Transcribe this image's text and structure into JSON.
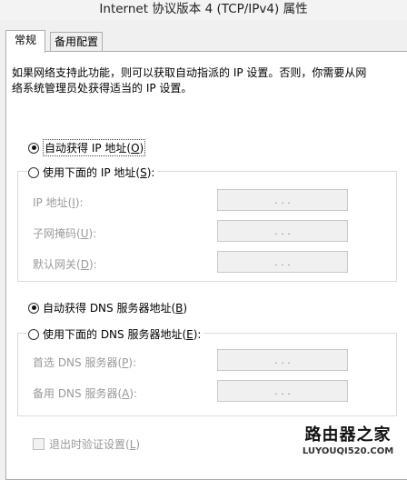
{
  "window": {
    "title": "Internet 协议版本 4 (TCP/IPv4) 属性"
  },
  "tabs": [
    {
      "label": "常规",
      "active": true
    },
    {
      "label": "备用配置",
      "active": false
    }
  ],
  "description": "如果网络支持此功能，则可以获取自动指派的 IP 设置。否则，你需要从网\n络系统管理员处获得适当的 IP 设置。",
  "ip_section": {
    "auto_option": {
      "label": "自动获得 IP 地址",
      "accel": "O",
      "selected": true
    },
    "manual_option": {
      "label": "使用下面的 IP 地址",
      "accel": "S",
      "selected": false
    },
    "fields": [
      {
        "label": "IP 地址",
        "accel": "I",
        "value": ". . ."
      },
      {
        "label": "子网掩码",
        "accel": "U",
        "value": ". . ."
      },
      {
        "label": "默认网关",
        "accel": "D",
        "value": ". . ."
      }
    ]
  },
  "dns_section": {
    "auto_option": {
      "label": "自动获得 DNS 服务器地址",
      "accel": "B",
      "selected": true
    },
    "manual_option": {
      "label": "使用下面的 DNS 服务器地址",
      "accel": "E",
      "selected": false
    },
    "fields": [
      {
        "label": "首选 DNS 服务器",
        "accel": "P",
        "value": ". . ."
      },
      {
        "label": "备用 DNS 服务器",
        "accel": "A",
        "value": ". . ."
      }
    ]
  },
  "validate_on_exit": {
    "label": "退出时验证设置",
    "accel": "L",
    "checked": false
  },
  "watermark": {
    "text_cn": "路由器之家",
    "text_en": "LUYOUQI520.COM"
  }
}
